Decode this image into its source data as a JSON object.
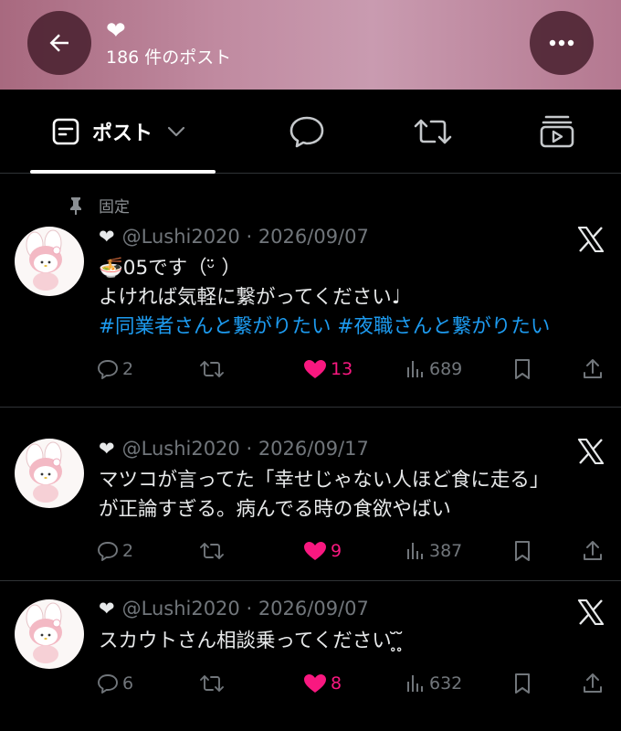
{
  "header": {
    "title": "❤",
    "post_count": "186 件のポスト"
  },
  "tabs": {
    "posts_label": "ポスト"
  },
  "pinned": {
    "label": "固定"
  },
  "tweets": [
    {
      "name_emoji": "❤",
      "handle": "@Lushi2020",
      "date": "2026/09/07",
      "lines": [
        "🍜05です（ᵕ̈ ）",
        "よければ気軽に繋がってください♩"
      ],
      "hashtags": "#同業者さんと繋がりたい #夜職さんと繋がりたい",
      "replies": "2",
      "likes": "13",
      "views": "689"
    },
    {
      "name_emoji": "❤",
      "handle": "@Lushi2020",
      "date": "2026/09/17",
      "lines": [
        "マツコが言ってた「幸せじゃない人ほど食に走る」",
        "が正論すぎる。病んでる時の食欲やばい"
      ],
      "hashtags": "",
      "replies": "2",
      "likes": "9",
      "views": "387"
    },
    {
      "name_emoji": "❤",
      "handle": "@Lushi2020",
      "date": "2026/09/07",
      "lines": [
        "スカウトさん相談乗ってください ̥̆ ̥̆ "
      ],
      "hashtags": "",
      "replies": "6",
      "likes": "8",
      "views": "632"
    }
  ],
  "colors": {
    "accent_link": "#1d9bf0",
    "like": "#f91880",
    "muted": "#71767b"
  }
}
